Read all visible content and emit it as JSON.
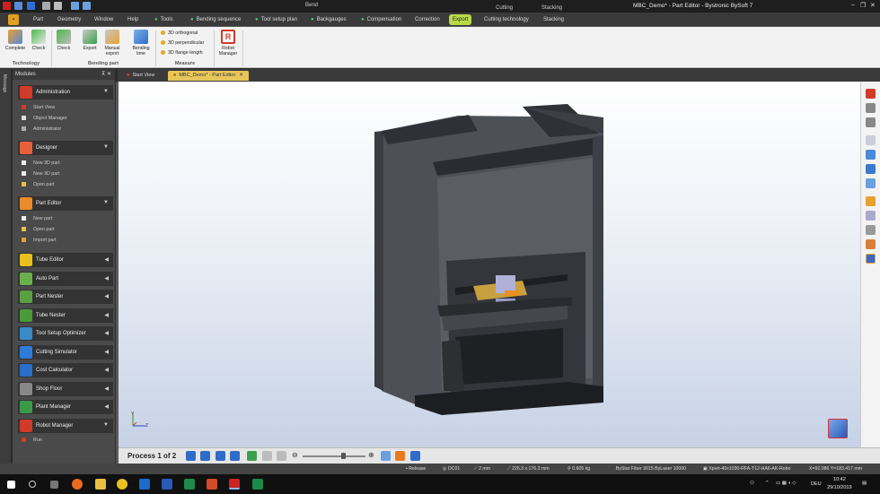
{
  "titlebar": {
    "context_bend": "Bend",
    "context_cutting": "Cutting",
    "context_stacking": "Stacking",
    "window_title": "MBC_Demo* - Part Editor - Bystronic BySoft 7",
    "minimize": "–",
    "restore": "❐",
    "close": "✕"
  },
  "tabs": {
    "part": "Part",
    "geometry": "Geometry",
    "window": "Window",
    "help": "Help",
    "tools": "Tools",
    "bending_sequence": "Bending sequence",
    "tool_setup_plan": "Tool setup plan",
    "backgauges": "Backgauges",
    "compensation": "Compensation",
    "correction": "Correction",
    "export": "Export",
    "cutting_technology": "Cutting technology",
    "stacking": "Stacking"
  },
  "ribbon": {
    "complete": "Complete",
    "check_tech": "Check",
    "group_technology": "Technology",
    "check": "Check",
    "export": "Export",
    "manual_export_1": "Manual",
    "manual_export_2": "export",
    "bending_time_1": "Bending",
    "bending_time_2": "time",
    "group_bending_part": "Bending part",
    "orthogonal": "3D orthogonal",
    "perpendicular": "3D perpendicular",
    "flange_length": "3D flange length",
    "group_measure": "Measure",
    "robot_manager_1": "Robot",
    "robot_manager_2": "Manager"
  },
  "side_strip": "Message",
  "modules": {
    "header": "Modules",
    "pin": "⊼ ✕",
    "administration": "Administration",
    "admin_items": [
      "Start View",
      "Object Manager",
      "Administrator"
    ],
    "designer": "Designer",
    "designer_items": [
      "New 3D part",
      "New 3D part",
      "Open part"
    ],
    "part_editor": "Part Editor",
    "part_editor_items": [
      "New part",
      "Open part",
      "Import part"
    ],
    "tube_editor": "Tube Editor",
    "auto_part": "Auto Part",
    "part_nester": "Part Nester",
    "tube_nester": "Tube Nester",
    "tool_setup_optimizer": "Tool Setup Optimizer",
    "cutting_simulator": "Cutting Simulator",
    "cost_calculator": "Cost Calculator",
    "shop_floor": "Shop Floor",
    "plant_manager": "Plant Manager",
    "robot_manager": "Robot Manager",
    "robot_items": [
      "Run"
    ],
    "arrow_down": "▼",
    "arrow_left": "◀"
  },
  "doc_tabs": {
    "start_view": "Start View",
    "active_doc": "MBC_Demo* - Part Editor",
    "close": "✕"
  },
  "axes": {
    "y": "Y",
    "z": "Z"
  },
  "process": {
    "label": "Process 1 of 2",
    "zoom_minus": "⊖",
    "zoom_plus": "⊕"
  },
  "statusbar": {
    "release": "Release",
    "dc": "DC01",
    "thickness": "2 mm",
    "size": "226.3 x 176.3 mm",
    "weight": "0.605 kg",
    "machine": "ByStar Fiber 3015 ByLaser 10000",
    "tool": "Xpert-40x1030-RFA-T12-HA6-AK-Robo",
    "coords": "X=92.086  Y=183.417 mm"
  },
  "taskbar": {
    "lang": "DEU",
    "time": "10:42",
    "date": "29/10/2019",
    "tray_chevron": "⌃"
  },
  "colors": {
    "accent_export": "#b8d94a",
    "admin_red": "#d23a2a",
    "designer_orange": "#e8603a",
    "part_editor_orange": "#ea8c2c",
    "green_module": "#6ab04c",
    "blue_module": "#2e7bd8"
  }
}
